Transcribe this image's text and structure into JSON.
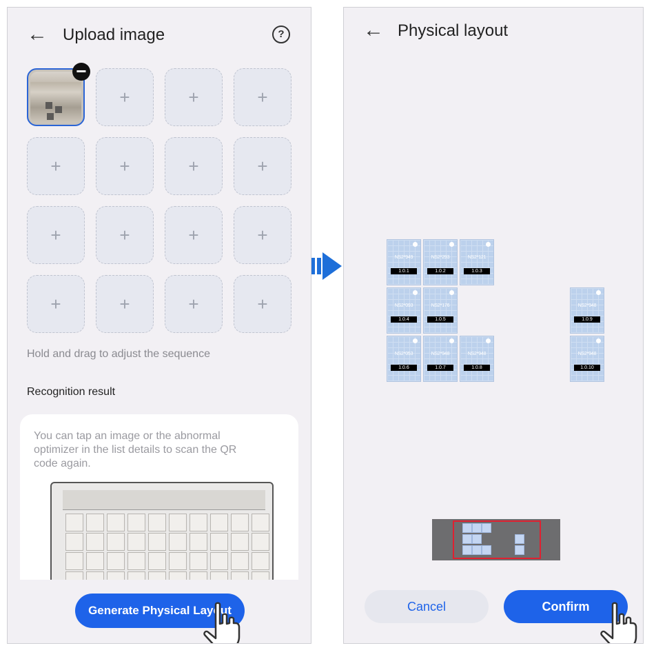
{
  "left_screen": {
    "title": "Upload image",
    "add_icon": "+",
    "hint": "Hold and drag to adjust the sequence",
    "section_label": "Recognition result",
    "result_text": "You can tap an image or the abnormal optimizer in the list details to scan the QR code again.",
    "generate_button": "Generate Physical Layout",
    "remove_badge": "−"
  },
  "right_screen": {
    "title": "Physical layout",
    "optimizers": [
      {
        "sn": "NS2*949",
        "tag": "1.0.1"
      },
      {
        "sn": "NS2*293",
        "tag": "1.0.2"
      },
      {
        "sn": "NS2*121",
        "tag": "1.0.3"
      },
      {
        "sn": "NS2*093",
        "tag": "1.0.4"
      },
      {
        "sn": "NS2*176",
        "tag": "1.0.5"
      },
      {
        "sn": "NS2*948",
        "tag": "1.0.9"
      },
      {
        "sn": "NS2*053",
        "tag": "1.0.6"
      },
      {
        "sn": "NS2*948",
        "tag": "1.0.7"
      },
      {
        "sn": "NS2*948",
        "tag": "1.0.8"
      },
      {
        "sn": "NS2*948",
        "tag": "1.0.10"
      }
    ],
    "cancel_button": "Cancel",
    "confirm_button": "Confirm"
  },
  "colors": {
    "primary": "#1e63e9",
    "screen_bg": "#f2f0f4",
    "optimizer_fill": "#bcd1ec",
    "minimap_frame": "#e02030",
    "flow_arrow": "#1e6fd9"
  },
  "icons": [
    "back-arrow-icon",
    "help-icon",
    "plus-icon",
    "remove-icon",
    "hand-pointer-icon",
    "flow-arrow-icon"
  ]
}
